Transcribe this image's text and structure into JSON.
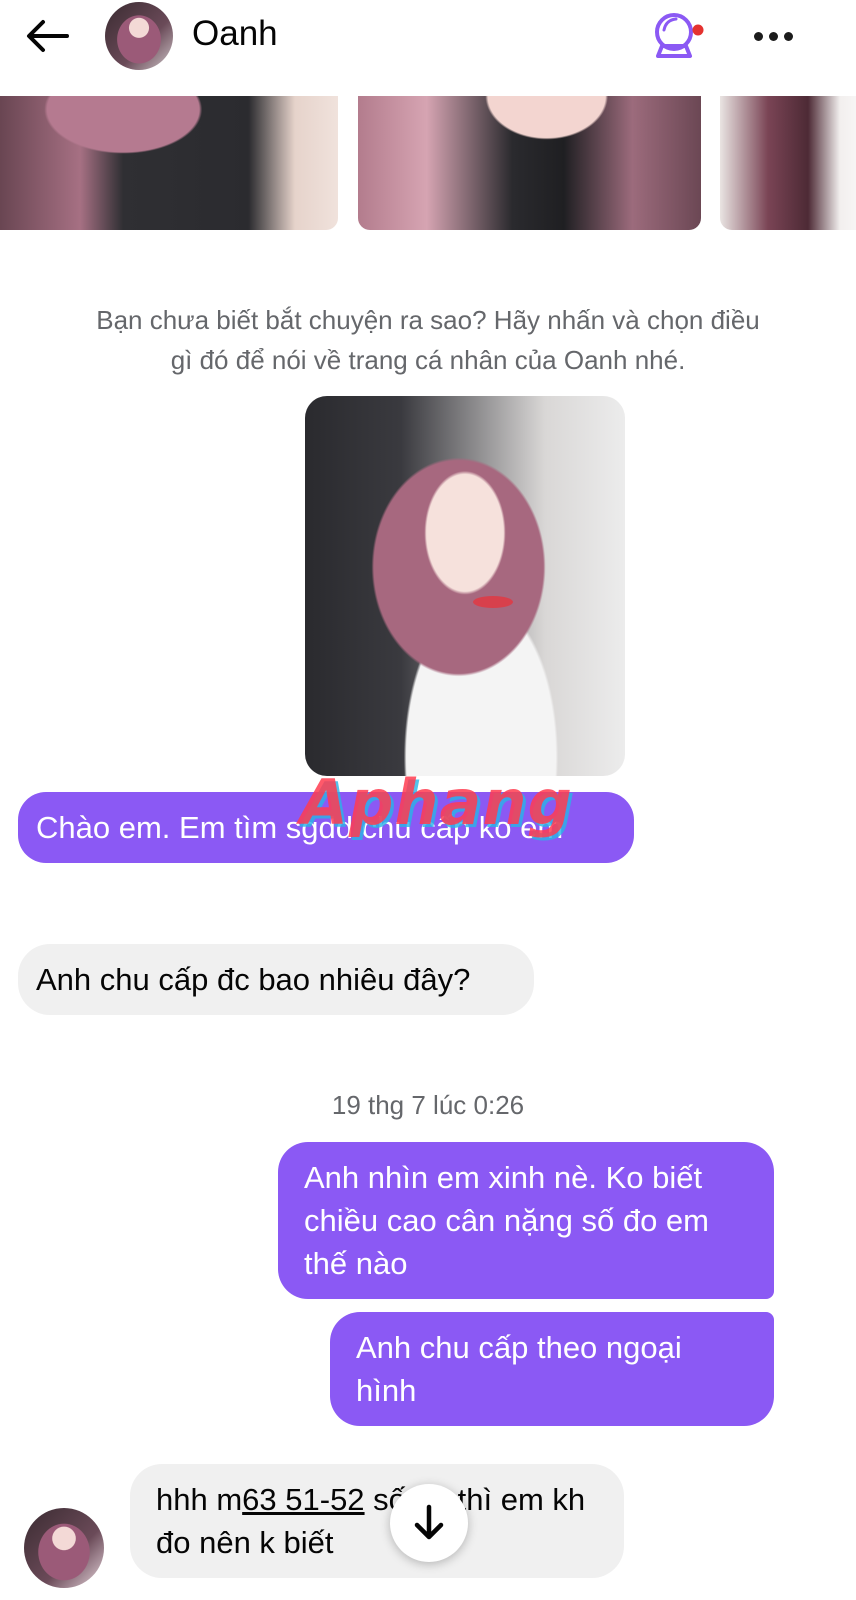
{
  "header": {
    "contact_name": "Oanh",
    "back_icon": "arrow-left-icon",
    "game_icon": "crystal-ball-icon",
    "more_icon": "more-horizontal-icon",
    "accent_color": "#8b59f4",
    "notification_dot_color": "#e4322f"
  },
  "suggestion": {
    "line1": "Bạn chưa biết bắt chuyện ra sao? Hãy nhấn và chọn điều",
    "line2": "gì đó để nói về trang cá nhân của Oanh nhé."
  },
  "watermark": "Aphang",
  "messages": [
    {
      "direction": "outgoing",
      "text": "Chào em. Em tìm sgdd chu cấp ko em"
    },
    {
      "direction": "incoming",
      "text": "Anh chu cấp đc bao nhiêu đây?"
    },
    {
      "direction": "outgoing",
      "text": "Anh nhìn em xinh nè. Ko biết chiều cao cân nặng số đo em thế nào"
    },
    {
      "direction": "outgoing",
      "text": "Anh chu cấp theo ngoại hình"
    },
    {
      "direction": "incoming",
      "prefix": "hhh m",
      "number": "63 51-52",
      "suffix": " số đo thì em kh đo nên k biết"
    }
  ],
  "timestamp": "19 thg 7 lúc 0:26",
  "colors": {
    "outgoing_bubble": "#8b59f4",
    "incoming_bubble": "#f0f0f0",
    "secondary_text": "#65676b"
  }
}
